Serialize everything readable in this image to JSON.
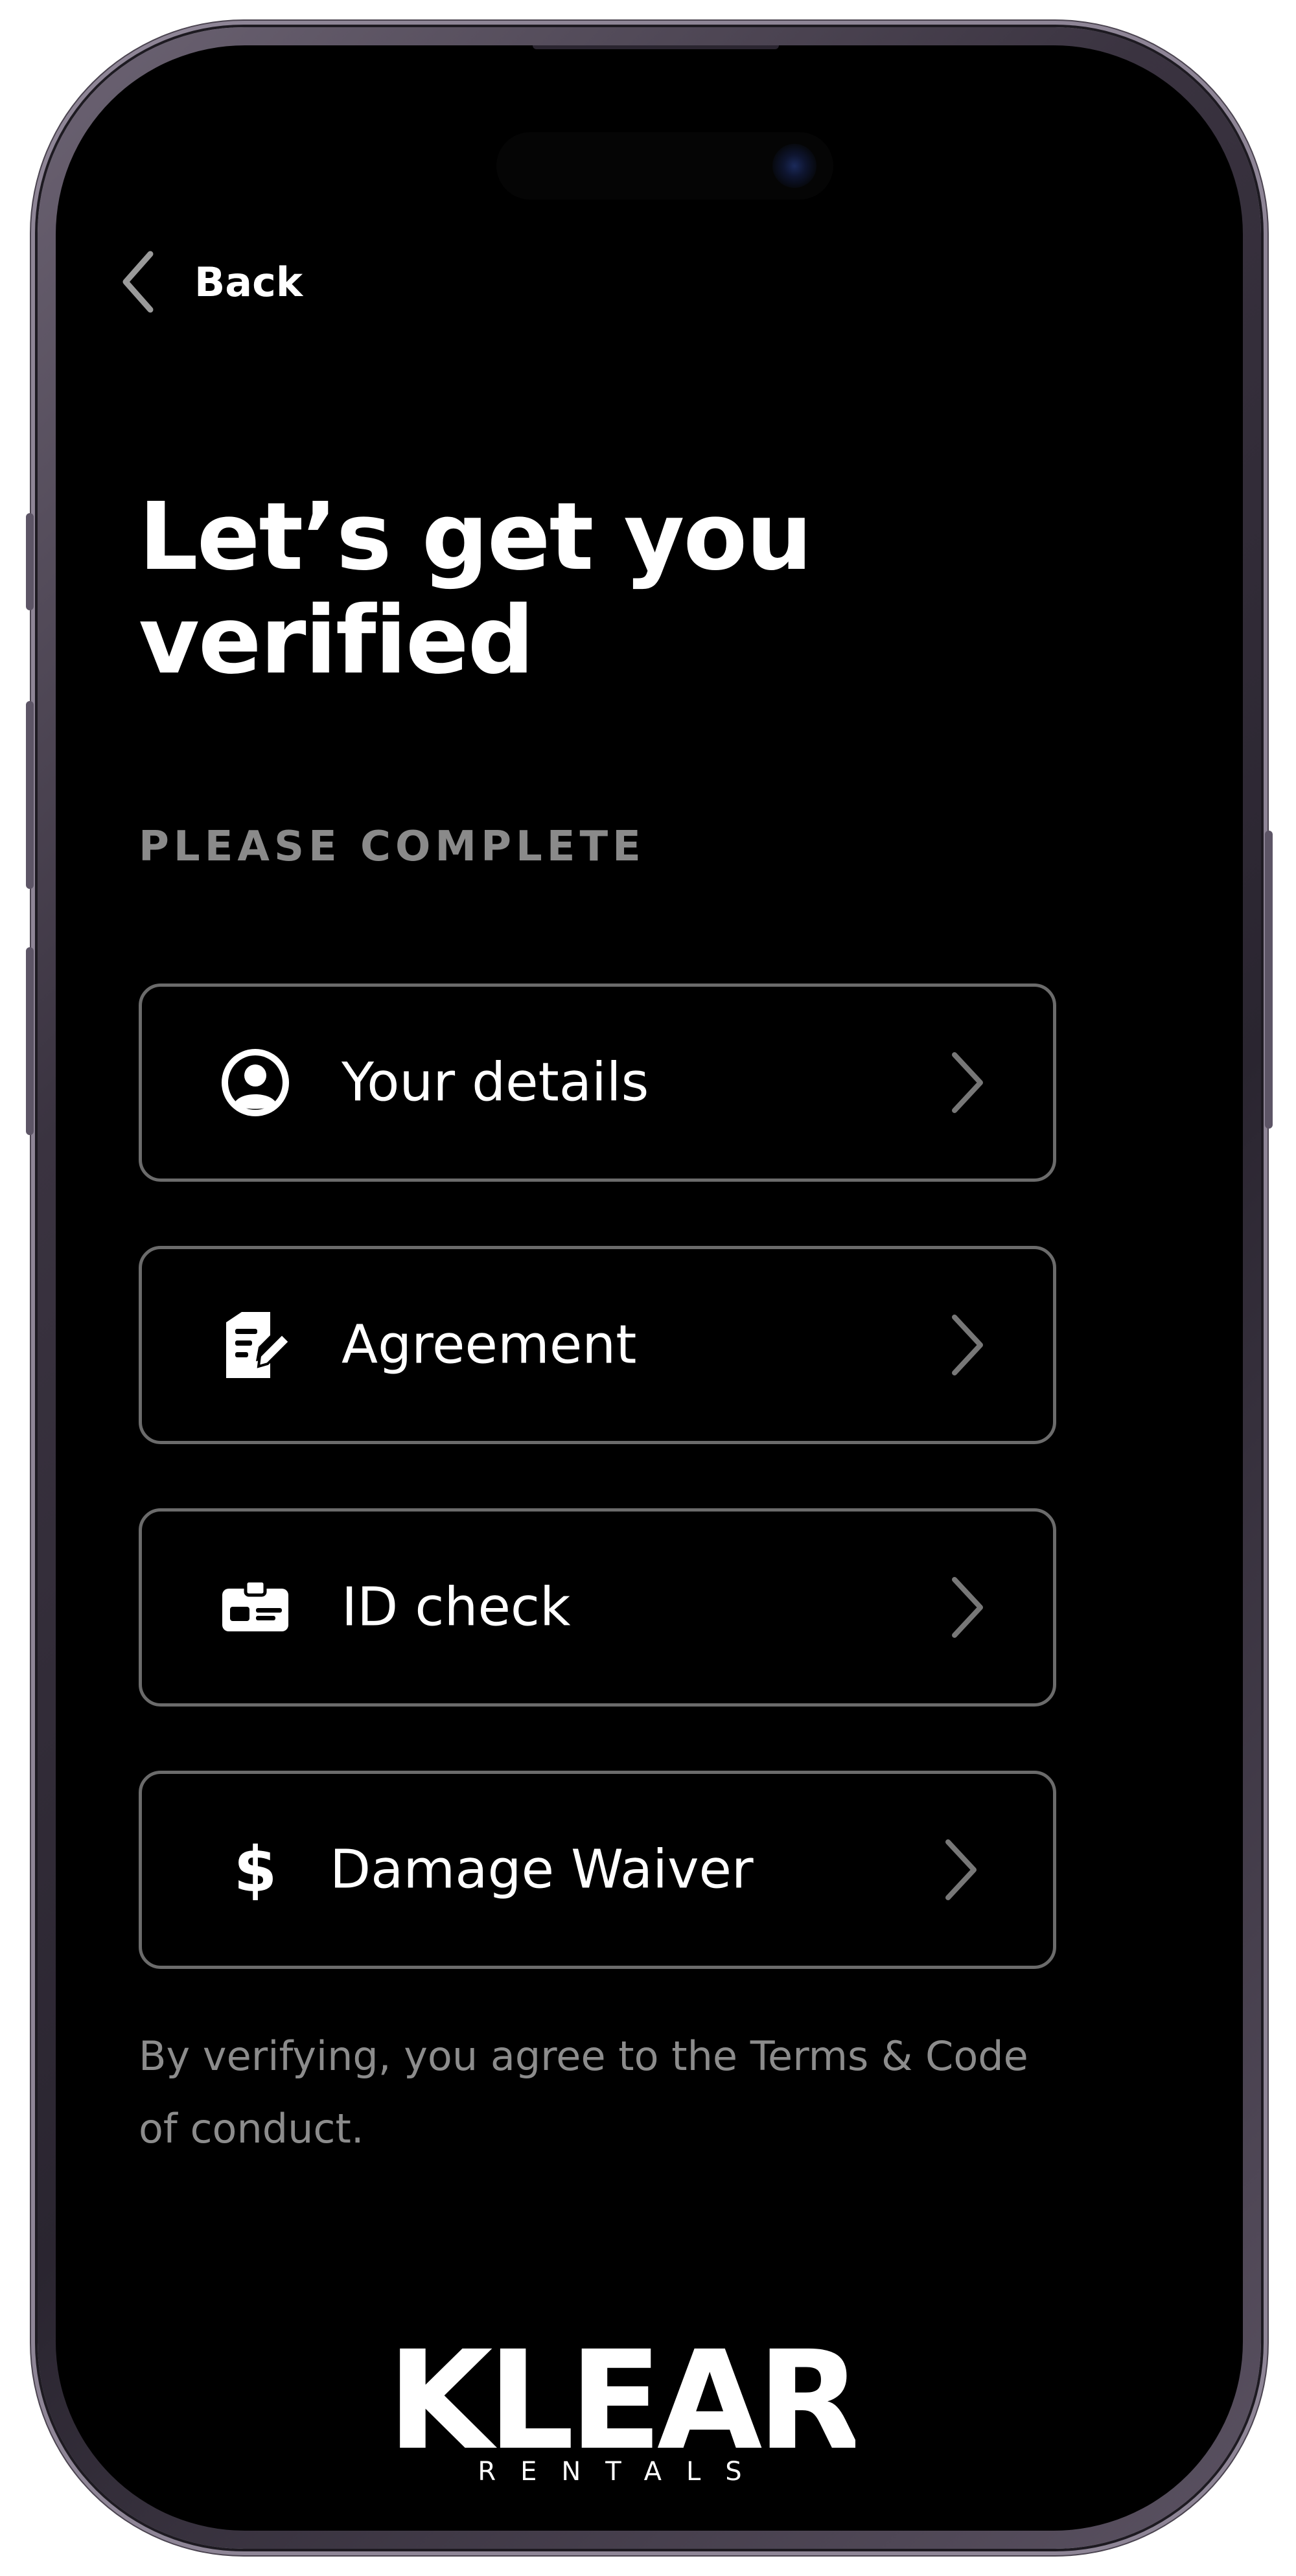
{
  "nav": {
    "back_label": "Back"
  },
  "page": {
    "title_line1": "Let’s get you",
    "title_line2": "verified",
    "section_label": "PLEASE COMPLETE"
  },
  "steps": [
    {
      "label": "Your details",
      "icon": "user-circle-icon"
    },
    {
      "label": "Agreement",
      "icon": "document-edit-icon"
    },
    {
      "label": "ID check",
      "icon": "id-card-icon"
    },
    {
      "label": "Damage Waiver",
      "icon": "dollar-icon",
      "glyph": "$"
    }
  ],
  "footer": {
    "terms_text": "By verifying, you agree to the Terms & Code of conduct."
  },
  "brand": {
    "logo_text": "KLEAR",
    "logo_subtext": "RENTALS"
  },
  "colors": {
    "background": "#000000",
    "text_primary": "#ffffff",
    "text_muted": "#8a8a8a",
    "card_border": "#6b6b6b",
    "chevron": "#777777"
  }
}
